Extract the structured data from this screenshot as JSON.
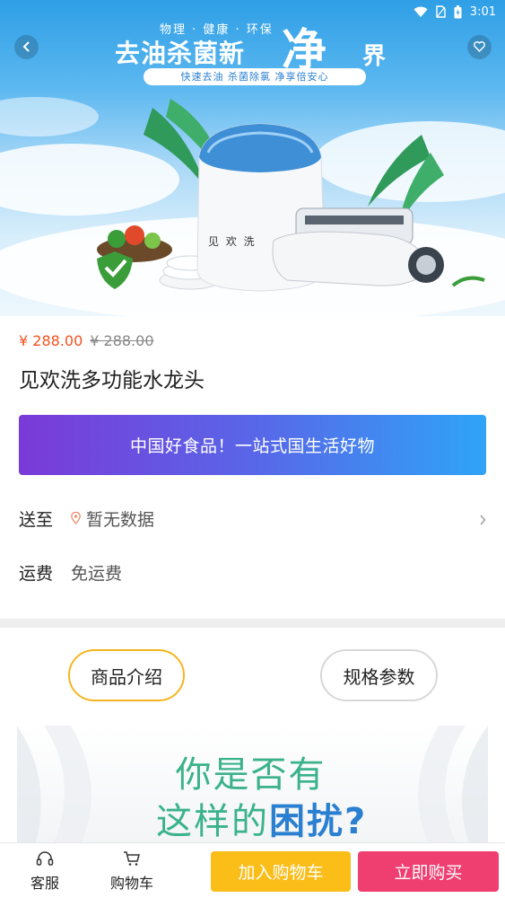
{
  "status_bar": {
    "time": "3:01"
  },
  "hero": {
    "tagline": "物理 · 健康 · 环保",
    "headline": "去油杀菌新",
    "headline_big": "净",
    "headline_tail": "界",
    "subline": "快速去油  杀菌除氯  净享倍安心",
    "brand_mark": "见 欢 洗"
  },
  "product": {
    "price_current": "¥ 288.00",
    "price_original": "¥ 288.00",
    "title": "见欢洗多功能水龙头"
  },
  "promo": {
    "text": "中国好食品！一站式国生活好物"
  },
  "shipping": {
    "label": "送至",
    "value": "暂无数据"
  },
  "freight": {
    "label": "运费",
    "value": "免运费"
  },
  "tabs": {
    "intro": "商品介绍",
    "spec": "规格参数"
  },
  "intro_image": {
    "line1": "你是否有",
    "line2_prefix": "这样的",
    "line2_emphasis": "困扰?"
  },
  "bottom_bar": {
    "service_label": "客服",
    "cart_label": "购物车",
    "add_to_cart": "加入购物车",
    "buy_now": "立即购买"
  },
  "colors": {
    "price": "#f4511e",
    "promo_start": "#7a3ad8",
    "promo_end": "#2fa4f7",
    "tab_active_border": "#f5b51f",
    "add_to_cart": "#fbbd18",
    "buy_now": "#ef3f70"
  },
  "icons": [
    "wifi-icon",
    "sim-icon",
    "battery-icon",
    "back-arrow-icon",
    "heart-icon",
    "location-pin-icon",
    "chevron-right-icon",
    "headset-icon",
    "cart-icon"
  ]
}
